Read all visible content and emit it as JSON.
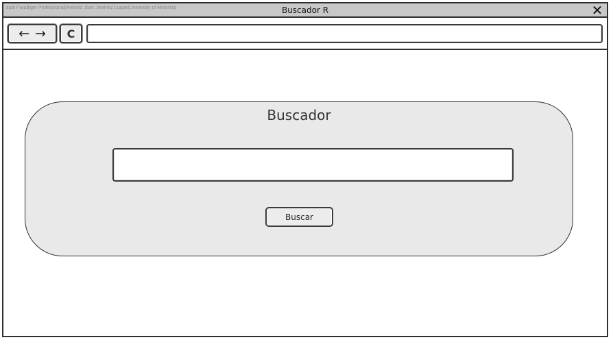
{
  "watermark": "sual Paradigm Professional(Antonio José Jiménez Luque(University of Almería))",
  "window": {
    "title": "Buscador R",
    "close_icon": "close-icon"
  },
  "toolbar": {
    "back_icon": "arrow-left-icon",
    "forward_icon": "arrow-right-icon",
    "reload_icon": "reload-icon",
    "back_glyph": "←",
    "forward_glyph": "→",
    "reload_glyph": "C",
    "address_value": ""
  },
  "panel": {
    "title": "Buscador",
    "search_value": "",
    "button_label": "Buscar"
  },
  "colors": {
    "titlebar": "#c8c8c8",
    "panel_background": "#e9e9e9",
    "border": "#2e2e2e"
  }
}
